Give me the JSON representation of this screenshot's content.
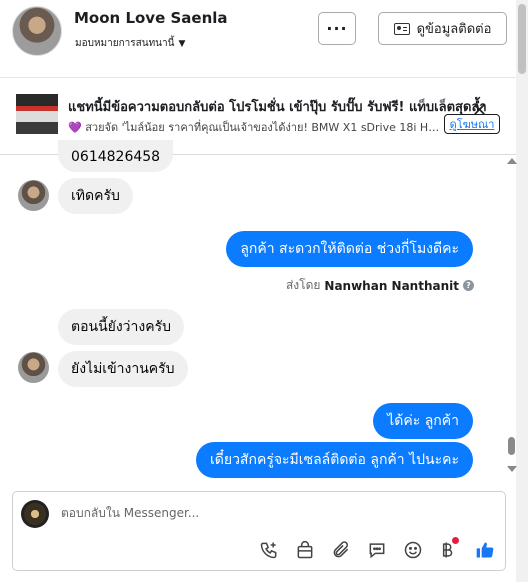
{
  "header": {
    "contact_name": "Moon Love Saenla",
    "assign_label": "มอบหมายการสนทนานี้",
    "more_label": "···",
    "info_button_label": "ดูข้อมูลติดต่อ"
  },
  "ad": {
    "title": "แชทนี้มีข้อความตอบกลับต่อ โปรโมชั่น เข้าปุ๊บ รับปั๊บ รับฟรี! แท็บเล็ตสุดล้ำ",
    "subtitle": "💜 สวยจัด 'ไมล์น้อย ราคาที่คุณเป็นเจ้าของได้ง่าย! BMW X1 sDrive 18i Hi...",
    "link_label": "ดูโฆษณา",
    "close_label": "✕"
  },
  "messages": [
    {
      "side": "left",
      "text": "0614826458"
    },
    {
      "side": "left",
      "text": "เทิดครับ"
    },
    {
      "side": "right",
      "text": "ลูกค้า  สะดวกให้ติดต่อ ช่วงกี่โมงดีคะ"
    },
    {
      "side": "left",
      "text": "ตอนนี้ยังว่างครับ"
    },
    {
      "side": "left",
      "text": "ยังไม่เข้างานครับ"
    },
    {
      "side": "right",
      "text": "ได้ค่ะ  ลูกค้า"
    },
    {
      "side": "right",
      "text": "เดี๋ยวสักครู่จะมีเซลล์ติดต่อ ลูกค้า  ไปนะคะ"
    }
  ],
  "sent_by": {
    "prefix": "ส่งโดย",
    "name": "Nanwhan Nanthanit",
    "help_icon": "?"
  },
  "composer": {
    "placeholder": "ตอบกลับใน Messenger...",
    "tools": [
      "call-add-icon",
      "shopping-bag-icon",
      "paperclip-icon",
      "chat-bubble-icon",
      "emoji-icon",
      "baht-icon",
      "thumbs-up-icon"
    ]
  },
  "colors": {
    "outgoing_bubble": "#0b7cff",
    "incoming_bubble": "#f0f0f0",
    "accent": "#1877f2",
    "notification_dot": "#e41e3f"
  }
}
